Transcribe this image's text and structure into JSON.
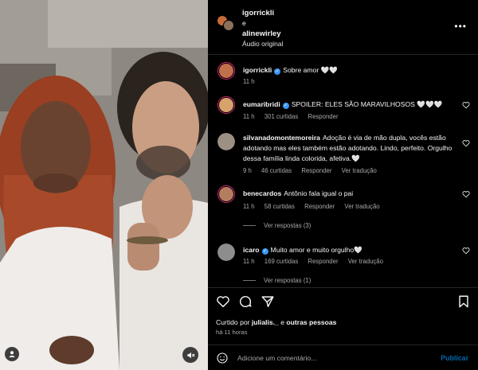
{
  "header": {
    "user1": "igorrickli",
    "separator": "e",
    "user2": "alinewirley",
    "audio": "Áudio original",
    "more_icon": "more-horizontal-icon"
  },
  "comments": [
    {
      "user": "igorrickli",
      "verified": true,
      "text": "Sobre amor 🤍🤍",
      "time": "11 h"
    },
    {
      "user": "eumaribridi",
      "verified": true,
      "text": "SPOILER: ELES SÃO MARAVILHOSOS 🤍🤍🤍",
      "time": "11 h",
      "likes": "301 curtidas",
      "reply": "Responder"
    },
    {
      "user": "silvanadomontemoreira",
      "verified": false,
      "text": "Adoção é via de mão dupla, vocês estão adotando mas eles também estão adotando. Lindo, perfeito. Orgulho dessa família linda colorida, afetiva.🤍",
      "time": "9 h",
      "likes": "46 curtidas",
      "reply": "Responder",
      "translate": "Ver tradução"
    },
    {
      "user": "benecardos",
      "verified": false,
      "text": "Antônio fala igual o pai",
      "time": "11 h",
      "likes": "58 curtidas",
      "reply": "Responder",
      "translate": "Ver tradução",
      "view_replies": "Ver respostas (3)"
    },
    {
      "user": "icaro",
      "verified": true,
      "text": "Muito amor e muito orgulho🤍",
      "time": "11 h",
      "likes": "169 curtidas",
      "reply": "Responder",
      "translate": "Ver tradução",
      "view_replies": "Ver respostas (1)"
    }
  ],
  "actions": {
    "icons": [
      "heart-icon",
      "comment-icon",
      "share-icon",
      "bookmark-icon"
    ],
    "liked_prefix": "Curtido por",
    "liked_user": "julialis._",
    "liked_and": "e",
    "liked_others": "outras pessoas",
    "time_ago": "há 11 horas"
  },
  "add_comment": {
    "placeholder": "Adicione um comentário...",
    "publish": "Publicar"
  },
  "colors": {
    "accent": "#0095f6",
    "verified": "#3897f0",
    "background": "#000000",
    "secondary_text": "#a8a8a8"
  }
}
